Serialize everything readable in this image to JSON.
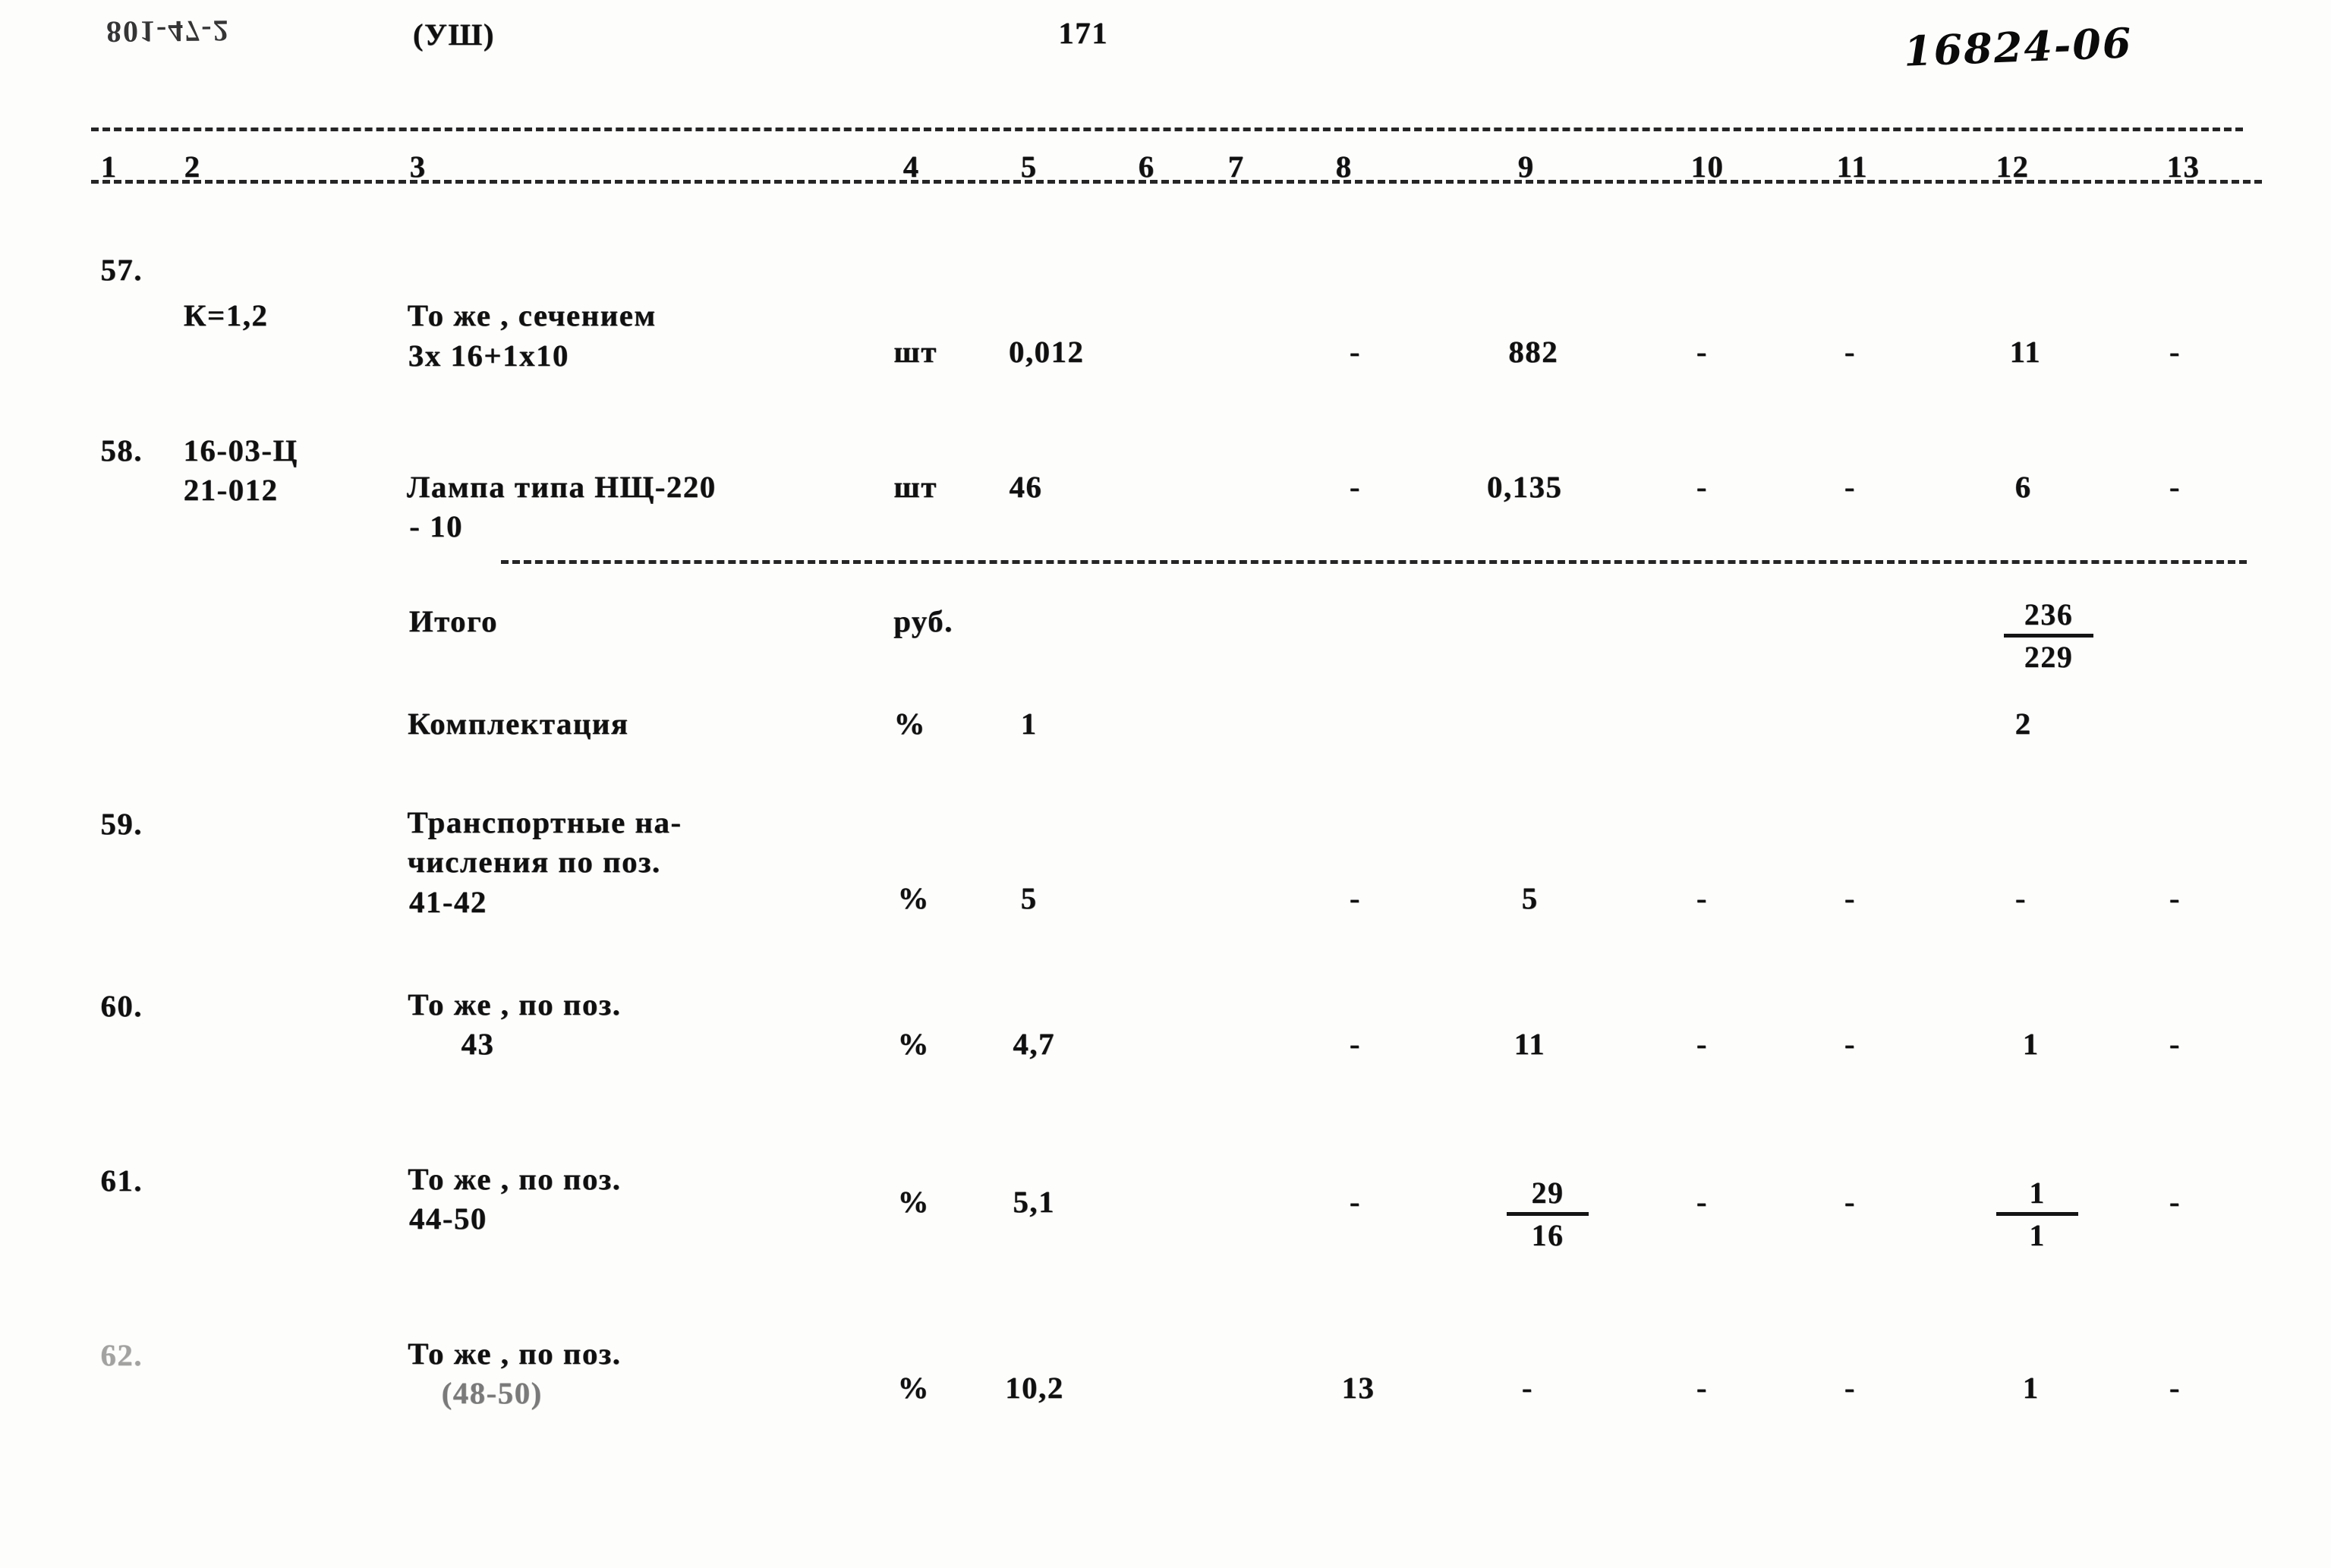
{
  "document": {
    "header": {
      "left_code": "801-47-2",
      "series_mark": "(УШ)",
      "page_number": "171",
      "handwritten_ref": "16824-06"
    },
    "column_headers": [
      "1",
      "2",
      "3",
      "4",
      "5",
      "6",
      "7",
      "8",
      "9",
      "10",
      "11",
      "12",
      "13"
    ],
    "rows": [
      {
        "num": "57.",
        "code_lines": [
          "",
          "К=1,2"
        ],
        "name_lines": [
          "То же , сечением",
          "3х 16+1х10"
        ],
        "unit": "шт",
        "c5": "0,012",
        "c6": "",
        "c7": "",
        "c8": "-",
        "c9": "882",
        "c10": "-",
        "c11": "-",
        "c12": "11",
        "c13": "-"
      },
      {
        "num": "58.",
        "code_lines": [
          "16-03-Ц",
          "21-012"
        ],
        "name_lines": [
          "Лампа типа НЩ-220",
          "- 10"
        ],
        "unit": "шт",
        "c5": "46",
        "c6": "",
        "c7": "",
        "c8": "-",
        "c9": "0,135",
        "c10": "-",
        "c11": "-",
        "c12": "6",
        "c13": "-"
      }
    ],
    "totals": {
      "itogo_label": "Итого",
      "itogo_unit": "руб.",
      "itogo_c12_num": "236",
      "itogo_c12_den": "229",
      "komplektacia_label": "Комплектация",
      "komplektacia_unit": "%",
      "komplektacia_c5": "1",
      "komplektacia_c12": "2"
    },
    "rows2": [
      {
        "num": "59.",
        "code_lines": [],
        "name_lines": [
          "Транспортные на-",
          "числения по поз.",
          "41-42"
        ],
        "unit": "%",
        "c5": "5",
        "c8": "-",
        "c9": "5",
        "c10": "-",
        "c11": "-",
        "c12": "-",
        "c13": "-"
      },
      {
        "num": "60.",
        "code_lines": [],
        "name_lines": [
          "То же , по поз.",
          "43"
        ],
        "unit": "%",
        "c5": "4,7",
        "c8": "-",
        "c9": "11",
        "c10": "-",
        "c11": "-",
        "c12": "1",
        "c13": "-"
      },
      {
        "num": "61.",
        "code_lines": [],
        "name_lines": [
          "То же , по поз.",
          "44-50"
        ],
        "unit": "%",
        "c5": "5,1",
        "c8": "-",
        "c9_num": "29",
        "c9_den": "16",
        "c10": "-",
        "c11": "-",
        "c12_num": "1",
        "c12_den": "1",
        "c13": "-"
      },
      {
        "num": "62.",
        "code_lines": [],
        "name_lines": [
          "То же , по поз.",
          "(48-50)"
        ],
        "unit": "%",
        "c5": "10,2",
        "c8": "13",
        "c9": "-",
        "c10": "-",
        "c11": "-",
        "c12": "1",
        "c13": "-"
      }
    ]
  }
}
